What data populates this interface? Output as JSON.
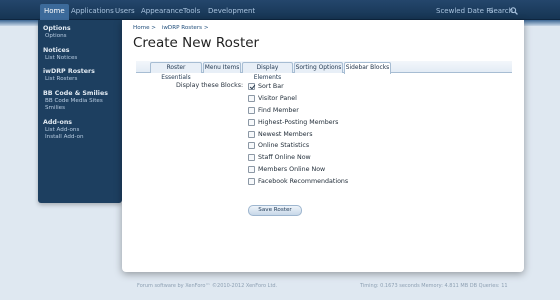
{
  "nav": {
    "tabs": [
      {
        "label": "Home",
        "active": true
      },
      {
        "label": "Applications",
        "active": false
      },
      {
        "label": "Users",
        "active": false
      },
      {
        "label": "Appearance",
        "active": false
      },
      {
        "label": "Tools",
        "active": false
      },
      {
        "label": "Development",
        "active": false
      }
    ],
    "user_link": "Scewled Date Ri",
    "search_label": "Search"
  },
  "sidebar": {
    "groups": [
      {
        "heading": "Options",
        "links": [
          "Options"
        ]
      },
      {
        "heading": "Notices",
        "links": [
          "List Notices"
        ]
      },
      {
        "heading": "iwDRP Rosters",
        "links": [
          "List Rosters"
        ]
      },
      {
        "heading": "BB Code & Smilies",
        "links": [
          "BB Code Media Sites",
          "Smilies"
        ]
      },
      {
        "heading": "Add-ons",
        "links": [
          "List Add-ons",
          "Install Add-on"
        ]
      }
    ]
  },
  "breadcrumb": [
    "Home >",
    "iwDRP Rosters >"
  ],
  "page_title": "Create New Roster",
  "tabs": [
    {
      "label": "Roster Essentials",
      "active": false
    },
    {
      "label": "Menu Items",
      "active": false
    },
    {
      "label": "Display Elements",
      "active": false
    },
    {
      "label": "Sorting Options",
      "active": false
    },
    {
      "label": "Sidebar Blocks",
      "active": true
    }
  ],
  "blocks_label": "Display these Blocks:",
  "blocks": [
    {
      "label": "Sort Bar",
      "checked": true
    },
    {
      "label": "Visitor Panel",
      "checked": false
    },
    {
      "label": "Find Member",
      "checked": false
    },
    {
      "label": "Highest-Posting Members",
      "checked": false
    },
    {
      "label": "Newest Members",
      "checked": false
    },
    {
      "label": "Online Statistics",
      "checked": false
    },
    {
      "label": "Staff Online Now",
      "checked": false
    },
    {
      "label": "Members Online Now",
      "checked": false
    },
    {
      "label": "Facebook Recommendations",
      "checked": false
    }
  ],
  "save_button": "Save Roster",
  "footer": {
    "left": "Forum software by XenForo™ ©2010-2012 XenForo Ltd.",
    "right": "Timing: 0.1673 seconds Memory: 4.811 MB DB Queries: 11"
  }
}
